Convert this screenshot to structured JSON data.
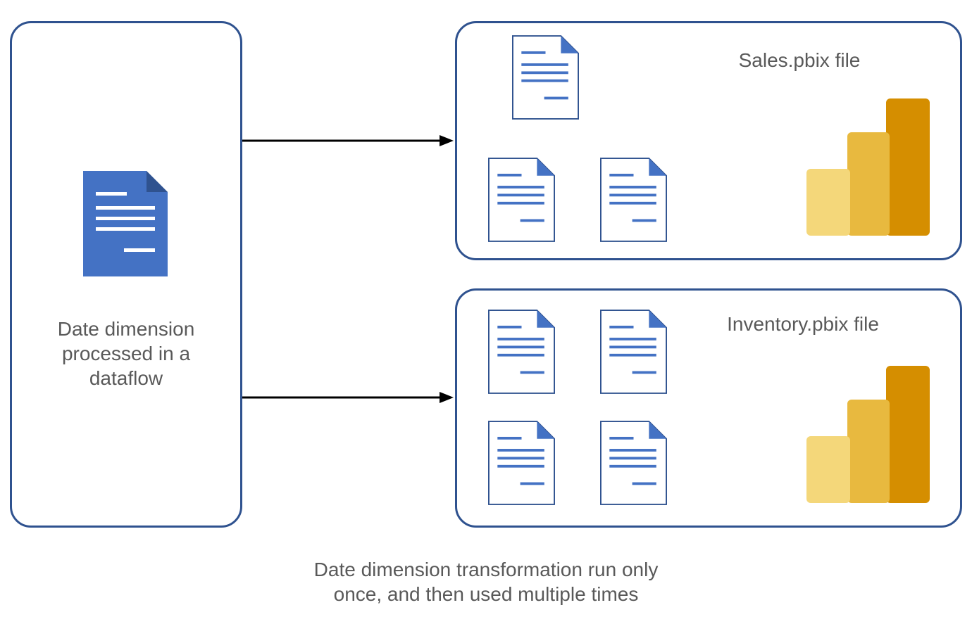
{
  "left": {
    "caption": "Date dimension\nprocessed in a\ndataflow"
  },
  "top_right": {
    "title": "Sales.pbix file"
  },
  "bottom_right": {
    "title": "Inventory.pbix file"
  },
  "footer": "Date dimension transformation run only\nonce, and then used multiple times"
}
